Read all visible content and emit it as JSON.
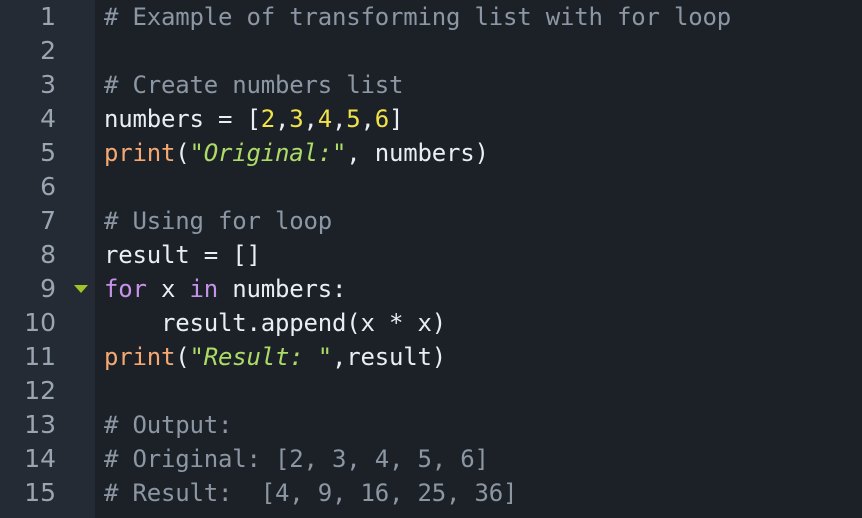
{
  "editor": {
    "theme_colors": {
      "background": "#1c2128",
      "gutter_background": "#252b34",
      "line_number": "#9aa5b1",
      "comment": "#8c97a3",
      "plain_text": "#e9eef4",
      "number_literal": "#f0e24a",
      "string_literal": "#addb67",
      "function_name": "#f5a871",
      "keyword": "#c792ea",
      "fold_marker": "#9ec428"
    },
    "language": "python",
    "line_numbers": [
      "1",
      "2",
      "3",
      "4",
      "5",
      "6",
      "7",
      "8",
      "9",
      "10",
      "11",
      "12",
      "13",
      "14",
      "15"
    ],
    "fold_marker_line": "9",
    "fold_marker_icon": "chevron-down-icon",
    "lines": [
      {
        "number": "1",
        "text": "# Example of transforming list with for loop",
        "tokens": [
          {
            "t": "# Example of transforming list with for loop",
            "c": "comment"
          }
        ]
      },
      {
        "number": "2",
        "text": "",
        "tokens": []
      },
      {
        "number": "3",
        "text": "# Create numbers list",
        "tokens": [
          {
            "t": "# Create numbers list",
            "c": "comment"
          }
        ]
      },
      {
        "number": "4",
        "text": "numbers = [2,3,4,5,6]",
        "tokens": [
          {
            "t": "numbers = [",
            "c": "plain"
          },
          {
            "t": "2",
            "c": "num"
          },
          {
            "t": ",",
            "c": "punct"
          },
          {
            "t": "3",
            "c": "num"
          },
          {
            "t": ",",
            "c": "punct"
          },
          {
            "t": "4",
            "c": "num"
          },
          {
            "t": ",",
            "c": "punct"
          },
          {
            "t": "5",
            "c": "num"
          },
          {
            "t": ",",
            "c": "punct"
          },
          {
            "t": "6",
            "c": "num"
          },
          {
            "t": "]",
            "c": "plain"
          }
        ]
      },
      {
        "number": "5",
        "text": "print(\"Original:\", numbers)",
        "tokens": [
          {
            "t": "print",
            "c": "fn"
          },
          {
            "t": "(",
            "c": "plain"
          },
          {
            "t": "\"Original:\"",
            "c": "str"
          },
          {
            "t": ", numbers)",
            "c": "plain"
          }
        ]
      },
      {
        "number": "6",
        "text": "",
        "tokens": []
      },
      {
        "number": "7",
        "text": "# Using for loop",
        "tokens": [
          {
            "t": "# Using for loop",
            "c": "comment"
          }
        ]
      },
      {
        "number": "8",
        "text": "result = []",
        "tokens": [
          {
            "t": "result = []",
            "c": "plain"
          }
        ]
      },
      {
        "number": "9",
        "text": "for x in numbers:",
        "tokens": [
          {
            "t": "for",
            "c": "kw"
          },
          {
            "t": " x ",
            "c": "plain"
          },
          {
            "t": "in",
            "c": "kw"
          },
          {
            "t": " numbers:",
            "c": "plain"
          }
        ]
      },
      {
        "number": "10",
        "text": "    result.append(x * x)",
        "tokens": [
          {
            "t": "    result.append(x * x)",
            "c": "plain"
          }
        ]
      },
      {
        "number": "11",
        "text": "print(\"Result: \",result)",
        "tokens": [
          {
            "t": "print",
            "c": "fn"
          },
          {
            "t": "(",
            "c": "plain"
          },
          {
            "t": "\"Result: \"",
            "c": "str"
          },
          {
            "t": ",result)",
            "c": "plain"
          }
        ]
      },
      {
        "number": "12",
        "text": "",
        "tokens": []
      },
      {
        "number": "13",
        "text": "# Output:",
        "tokens": [
          {
            "t": "# Output:",
            "c": "comment"
          }
        ]
      },
      {
        "number": "14",
        "text": "# Original: [2, 3, 4, 5, 6]",
        "tokens": [
          {
            "t": "# Original: [2, 3, 4, 5, 6]",
            "c": "comment"
          }
        ]
      },
      {
        "number": "15",
        "text": "# Result:  [4, 9, 16, 25, 36]",
        "tokens": [
          {
            "t": "# Result:  [4, 9, 16, 25, 36]",
            "c": "comment"
          }
        ]
      }
    ]
  }
}
